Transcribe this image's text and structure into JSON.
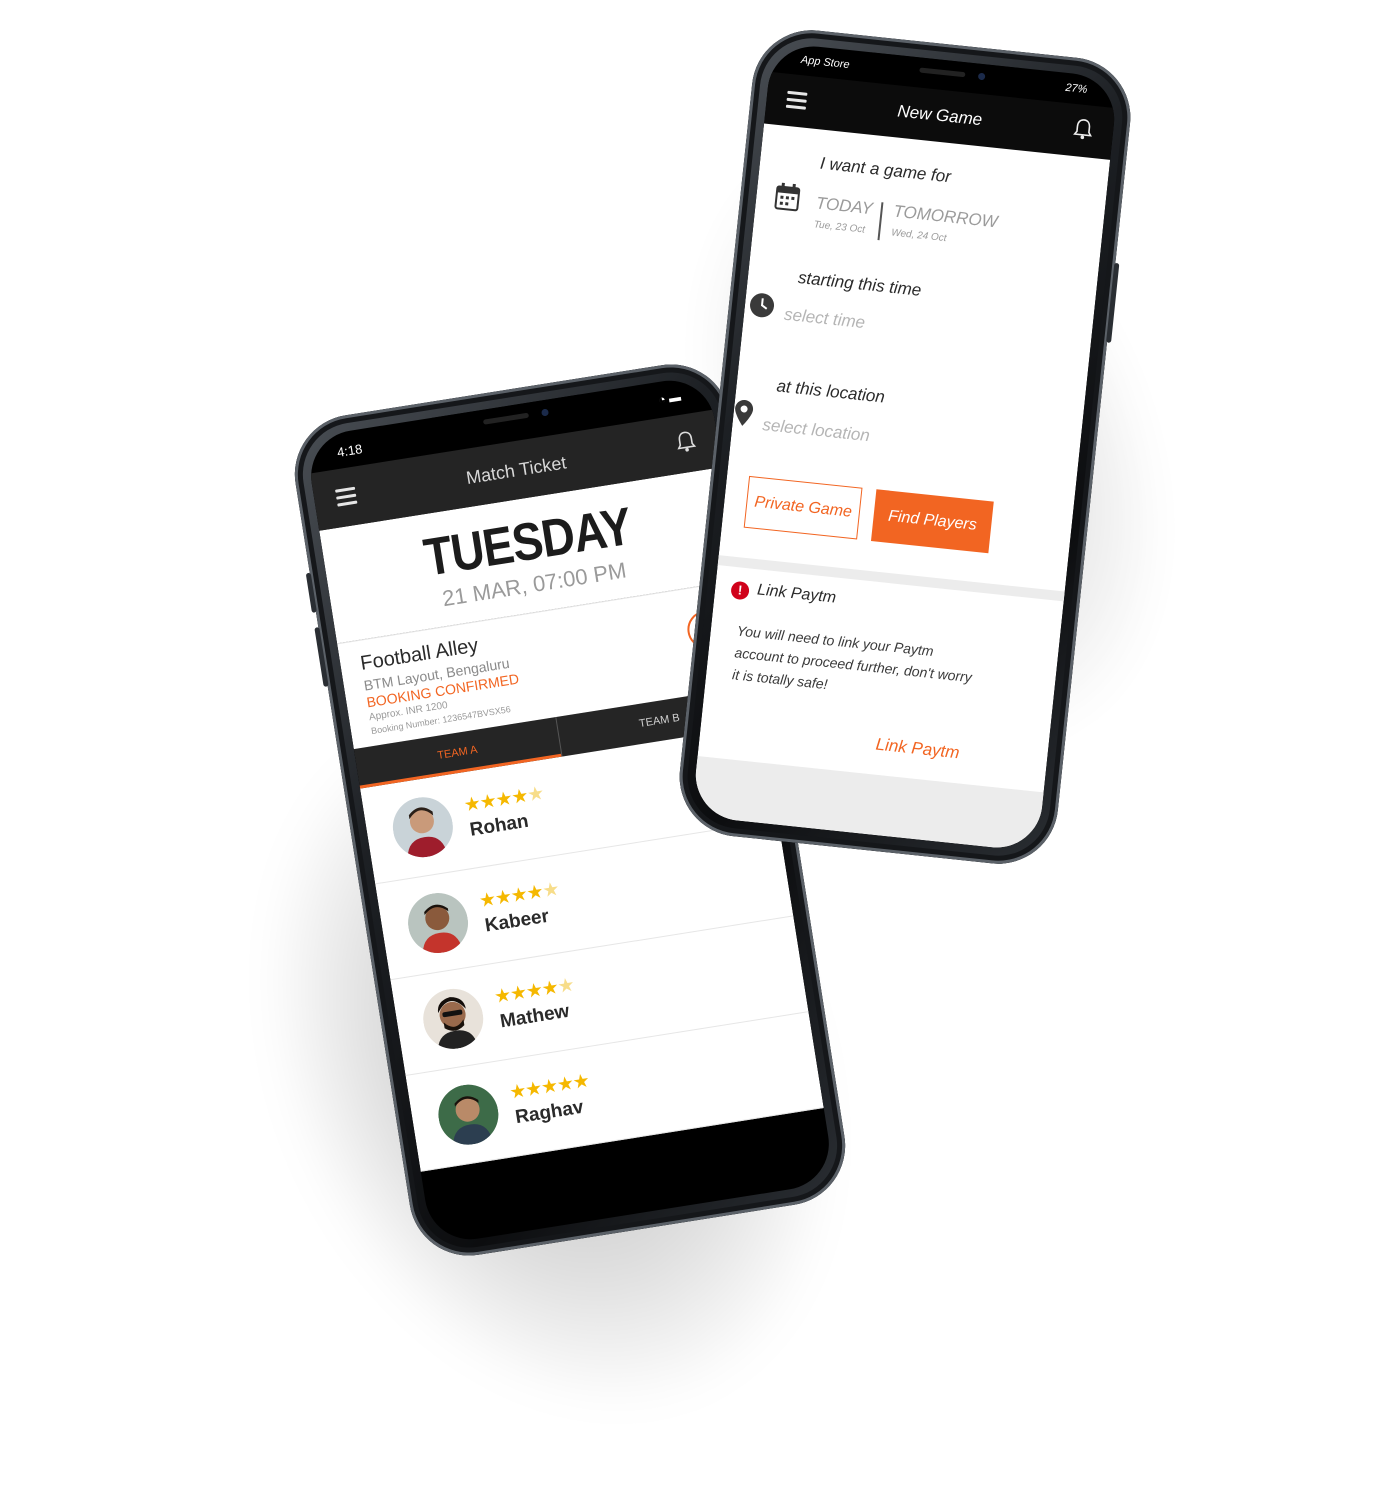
{
  "colors": {
    "accent": "#f26522",
    "star": "#f5b800",
    "dark_header": "#242424"
  },
  "match_ticket": {
    "status_bar": {
      "time": "4:18"
    },
    "header": {
      "title": "Match Ticket"
    },
    "day": "TUESDAY",
    "date_time": "21 MAR, 07:00 PM",
    "venue": {
      "name": "Football Alley",
      "address": "BTM Layout, Bengaluru",
      "status": "BOOKING CONFIRMED",
      "approx": "Approx. INR 1200",
      "booking_number": "Booking Number: 1236547BVSX56"
    },
    "tabs": [
      {
        "label": "TEAM A"
      },
      {
        "label": "TEAM B"
      }
    ],
    "players": [
      {
        "name": "Rohan",
        "stars": 4
      },
      {
        "name": "Kabeer",
        "stars": 4
      },
      {
        "name": "Mathew",
        "stars": 4
      },
      {
        "name": "Raghav",
        "stars": 5
      }
    ]
  },
  "new_game": {
    "status_bar": {
      "left": "App Store",
      "right": "27%"
    },
    "header": {
      "title": "New Game"
    },
    "when": {
      "title": "I want a game for",
      "options": [
        {
          "label": "TODAY",
          "sub": "Tue, 23 Oct"
        },
        {
          "label": "TOMORROW",
          "sub": "Wed, 24 Oct"
        }
      ]
    },
    "time": {
      "title": "starting this time",
      "placeholder": "select time"
    },
    "location": {
      "title": "at this location",
      "placeholder": "select location"
    },
    "buttons": {
      "private": "Private Game",
      "find": "Find Players"
    },
    "paytm": {
      "title": "Link Paytm",
      "body": "You will need to link your Paytm account to proceed further, don't worry it is totally safe!",
      "link": "Link Paytm"
    }
  }
}
